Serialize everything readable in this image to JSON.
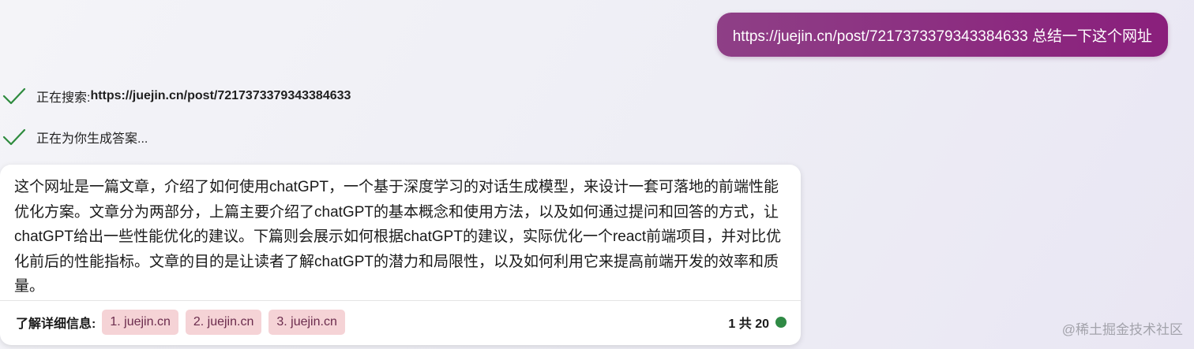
{
  "user_message": {
    "text": "https://juejin.cn/post/7217373379343384633 总结一下这个网址"
  },
  "status": [
    {
      "icon": "check-icon",
      "label": "正在搜索: ",
      "link": "https://juejin.cn/post/7217373379343384633"
    },
    {
      "icon": "check-icon",
      "label": "正在为你生成答案..."
    }
  ],
  "answer": {
    "text": "这个网址是一篇文章，介绍了如何使用chatGPT，一个基于深度学习的对话生成模型，来设计一套可落地的前端性能优化方案。文章分为两部分，上篇主要介绍了chatGPT的基本概念和使用方法，以及如何通过提问和回答的方式，让chatGPT给出一些性能优化的建议。下篇则会展示如何根据chatGPT的建议，实际优化一个react前端项目，并对比优化前后的性能指标。文章的目的是让读者了解chatGPT的潜力和局限性，以及如何利用它来提高前端开发的效率和质量。",
    "learn_more_label": "了解详细信息:",
    "sources": [
      {
        "label": "1. juejin.cn"
      },
      {
        "label": "2. juejin.cn"
      },
      {
        "label": "3. juejin.cn"
      }
    ],
    "turn_counter": "1 共 20"
  },
  "watermark": "@稀土掘金技术社区",
  "colors": {
    "user_bubble_start": "#8e3f86",
    "user_bubble_end": "#8a1f7c",
    "check": "#2e8b3e",
    "chip_bg": "#f5d3d6",
    "chip_text": "#6b2c4d",
    "status_dot": "#2f8a45"
  }
}
